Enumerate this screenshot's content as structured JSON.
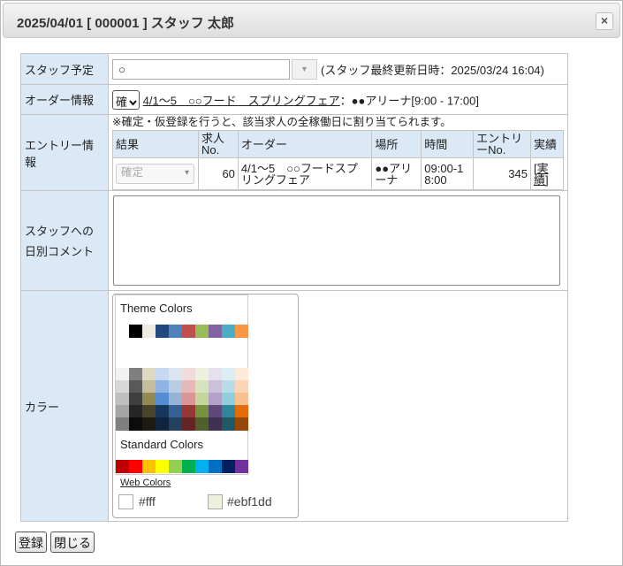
{
  "dialog": {
    "title": "2025/04/01 [ 000001 ] スタッフ 太郎",
    "close_symbol": "×"
  },
  "staff": {
    "label": "スタッフ予定",
    "value": "○",
    "dropdown_symbol": "▼",
    "update_note": "(スタッフ最終更新日時：2025/03/24 16:04)"
  },
  "order": {
    "label": "オーダー情報",
    "status": "確",
    "link_text": "4/1～5　○○フード　スプリングフェア",
    "detail": "：●●アリーナ[9:00 - 17:00]"
  },
  "entry": {
    "label": "エントリー情報",
    "note": "※確定・仮登録を行うと、該当求人の全稼働日に割り当てられます。",
    "headers": [
      "結果",
      "求人No.",
      "オーダー",
      "場所",
      "時間",
      "エントリーNo.",
      "実績"
    ],
    "row": {
      "result": "確定",
      "job_no": "60",
      "order": "4/1～5　○○フードスプリングフェア",
      "place": "●●アリーナ",
      "time": "09:00-18:00",
      "entry_no": "345",
      "record": "[実績]"
    }
  },
  "comment": {
    "label_line1": "スタッフへの",
    "label_line2": "日別コメント",
    "value": ""
  },
  "color": {
    "label": "カラー",
    "theme_heading": "Theme Colors",
    "standard_heading": "Standard Colors",
    "web_link": "Web Colors",
    "theme_top": [
      "#ffffff",
      "#000000",
      "#eeece1",
      "#1f497d",
      "#4f81bd",
      "#c0504d",
      "#9bbb59",
      "#8064a2",
      "#4bacc6",
      "#f79646"
    ],
    "theme_shades": [
      [
        "#f2f2f2",
        "#7f7f7f",
        "#ddd9c3",
        "#c6d9f0",
        "#dbe5f1",
        "#f2dcdb",
        "#ebf1dd",
        "#e5e0ec",
        "#dbeef3",
        "#fdeada"
      ],
      [
        "#d8d8d8",
        "#595959",
        "#c4bd97",
        "#8db3e2",
        "#b8cce4",
        "#e5b9b7",
        "#d7e3bc",
        "#ccc1d9",
        "#b7dde8",
        "#fbd5b5"
      ],
      [
        "#bfbfbf",
        "#3f3f3f",
        "#938953",
        "#548dd4",
        "#95b3d7",
        "#d99694",
        "#c3d69b",
        "#b2a2c7",
        "#92cddc",
        "#fac08f"
      ],
      [
        "#a5a5a5",
        "#262626",
        "#494429",
        "#17365d",
        "#366092",
        "#953734",
        "#76923c",
        "#5f497a",
        "#31859b",
        "#e36c09"
      ],
      [
        "#7f7f7f",
        "#0c0c0c",
        "#1d1b10",
        "#0f243e",
        "#244061",
        "#632423",
        "#4f6128",
        "#3f3151",
        "#205867",
        "#974806"
      ]
    ],
    "standard": [
      "#c00000",
      "#ff0000",
      "#ffc000",
      "#ffff00",
      "#92d050",
      "#00b050",
      "#00b0f0",
      "#0070c0",
      "#002060",
      "#7030a0"
    ],
    "original_color": "#fff",
    "selected_color": "#ebf1dd"
  },
  "buttons": {
    "register": "登録",
    "close": "閉じる"
  }
}
